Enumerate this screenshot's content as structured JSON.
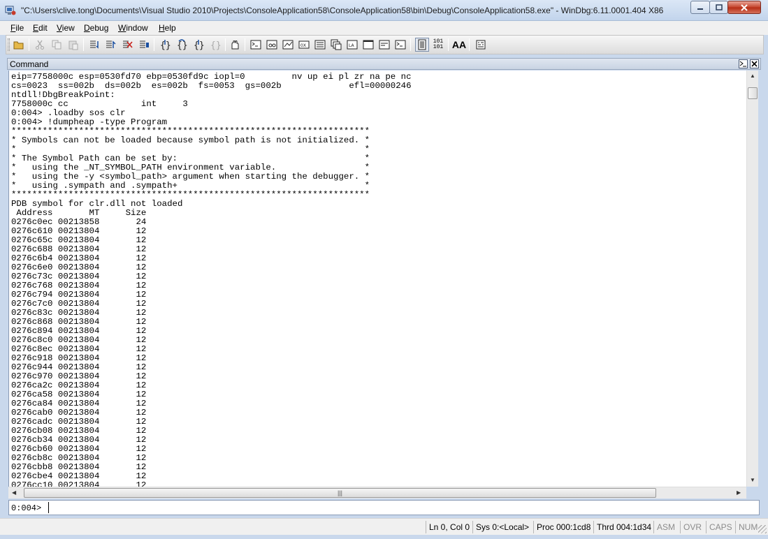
{
  "window": {
    "title": "\"C:\\Users\\clive.tong\\Documents\\Visual Studio 2010\\Projects\\ConsoleApplication58\\ConsoleApplication58\\bin\\Debug\\ConsoleApplication58.exe\" - WinDbg:6.11.0001.404 X86"
  },
  "menu": {
    "file": "File",
    "edit": "Edit",
    "view": "View",
    "debug": "Debug",
    "window": "Window",
    "help": "Help"
  },
  "toolbar": {
    "icons": [
      "open-icon",
      "cut-icon",
      "copy-icon",
      "paste-icon",
      "go-icon",
      "restart-icon",
      "stop-debugging-icon",
      "break-icon",
      "step-into-icon",
      "step-over-icon",
      "step-out-icon",
      "run-to-cursor-icon",
      "insert-breakpoint-icon",
      "command-window-icon",
      "watch-window-icon",
      "locals-window-icon",
      "registers-window-icon",
      "memory-window-icon",
      "call-stack-window-icon",
      "disassembly-window-icon",
      "scratch-pad-icon",
      "processes-threads-icon",
      "source-mode-icon",
      "hex-display-icon",
      "font-icon",
      "options-icon"
    ],
    "hex_label": "101\n101",
    "font_label": "AA"
  },
  "command_pane": {
    "title": "Command",
    "output_lines": [
      "eip=7758000c esp=0530fd70 ebp=0530fd9c iopl=0         nv up ei pl zr na pe nc",
      "cs=0023  ss=002b  ds=002b  es=002b  fs=0053  gs=002b             efl=00000246",
      "ntdll!DbgBreakPoint:",
      "7758000c cc              int     3",
      "0:004> .loadby sos clr",
      "0:004> !dumpheap -type Program",
      "*********************************************************************",
      "* Symbols can not be loaded because symbol path is not initialized. *",
      "*                                                                   *",
      "* The Symbol Path can be set by:                                    *",
      "*   using the _NT_SYMBOL_PATH environment variable.                 *",
      "*   using the -y <symbol_path> argument when starting the debugger. *",
      "*   using .sympath and .sympath+                                    *",
      "*********************************************************************",
      "PDB symbol for clr.dll not loaded",
      " Address       MT     Size",
      "0276c0ec 00213858       24",
      "0276c610 00213804       12",
      "0276c65c 00213804       12",
      "0276c688 00213804       12",
      "0276c6b4 00213804       12",
      "0276c6e0 00213804       12",
      "0276c73c 00213804       12",
      "0276c768 00213804       12",
      "0276c794 00213804       12",
      "0276c7c0 00213804       12",
      "0276c83c 00213804       12",
      "0276c868 00213804       12",
      "0276c894 00213804       12",
      "0276c8c0 00213804       12",
      "0276c8ec 00213804       12",
      "0276c918 00213804       12",
      "0276c944 00213804       12",
      "0276c970 00213804       12",
      "0276ca2c 00213804       12",
      "0276ca58 00213804       12",
      "0276ca84 00213804       12",
      "0276cab0 00213804       12",
      "0276cadc 00213804       12",
      "0276cb08 00213804       12",
      "0276cb34 00213804       12",
      "0276cb60 00213804       12",
      "0276cb8c 00213804       12",
      "0276cbb8 00213804       12",
      "0276cbe4 00213804       12",
      "0276cc10 00213804       12"
    ],
    "prompt": "0:004>",
    "input_value": ""
  },
  "statusbar": {
    "position": "Ln 0, Col 0",
    "system": "Sys 0:<Local>",
    "process": "Proc 000:1cd8",
    "thread": "Thrd 004:1d34",
    "asm": "ASM",
    "ovr": "OVR",
    "caps": "CAPS",
    "num": "NUM"
  }
}
